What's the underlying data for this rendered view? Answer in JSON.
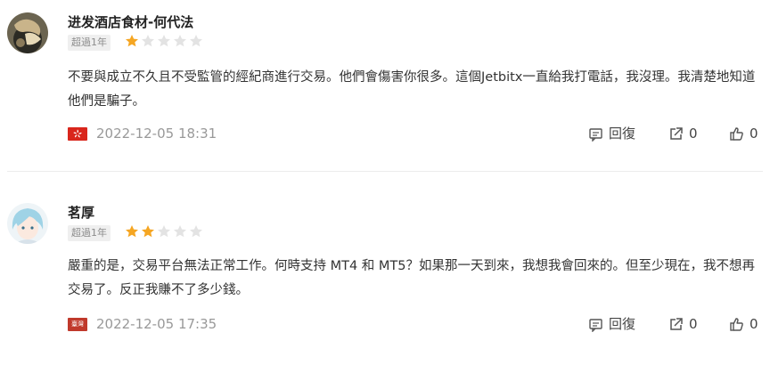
{
  "reviews": [
    {
      "username": "进发酒店食材-何代法",
      "tenure": "超過1年",
      "rating": 1,
      "max_rating": 5,
      "body": "不要與成立不久且不受監管的經紀商進行交易。他們會傷害你很多。這個Jetbitx一直給我打電話，我沒理。我清楚地知道他們是騙子。",
      "flag_icon": "hong-kong-flag-icon",
      "timestamp": "2022-12-05 18:31",
      "reply_label": "回復",
      "share_count": "0",
      "like_count": "0"
    },
    {
      "username": "茗厚",
      "tenure": "超過1年",
      "rating": 2,
      "max_rating": 5,
      "body": "嚴重的是，交易平台無法正常工作。何時支持 MT4 和 MT5？如果那一天到來，我想我會回來的。但至少現在，我不想再交易了。反正我賺不了多少錢。",
      "flag_icon": "taiwan-flag-icon",
      "flag_text": "臺灣",
      "timestamp": "2022-12-05 17:35",
      "reply_label": "回復",
      "share_count": "0",
      "like_count": "0"
    }
  ],
  "colors": {
    "star_filled": "#f5a623",
    "star_empty": "#e3e3e3",
    "flag_red": "#d9261c",
    "text_muted": "#999999"
  }
}
